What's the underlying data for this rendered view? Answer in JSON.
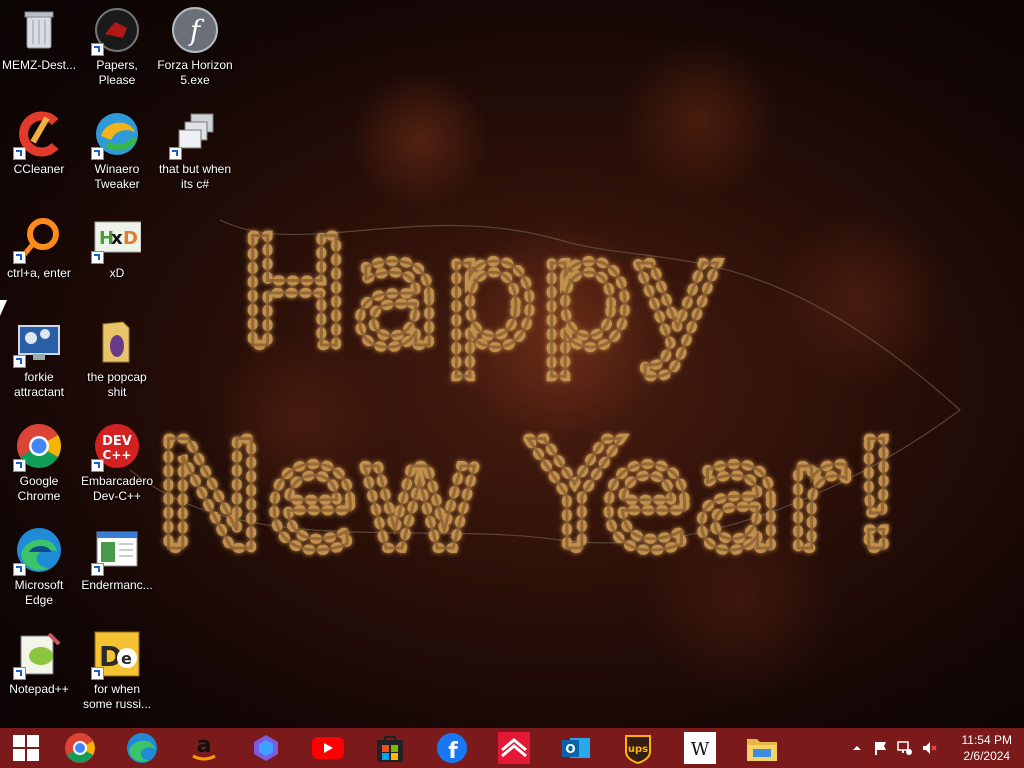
{
  "desktop_icons": [
    {
      "label": "MEMZ-Dest...",
      "icon": "recycle-bin-icon"
    },
    {
      "label": "Papers, Please",
      "icon": "papers-please-icon"
    },
    {
      "label": "Forza Horizon 5.exe",
      "icon": "flash-icon"
    },
    {
      "label": "CCleaner",
      "icon": "ccleaner-icon"
    },
    {
      "label": "Winaero Tweaker",
      "icon": "winaero-icon"
    },
    {
      "label": "that but when its c#",
      "icon": "windows-stack-icon"
    },
    {
      "label": "ctrl+a, enter",
      "icon": "ring-icon"
    },
    {
      "label": "xD",
      "icon": "hxd-icon"
    },
    {
      "label": "forkie attractant",
      "icon": "settings-monitor-icon"
    },
    {
      "label": "the popcap shit",
      "icon": "folder-icon"
    },
    {
      "label": "Google Chrome",
      "icon": "chrome-icon"
    },
    {
      "label": "Embarcadero Dev-C++",
      "icon": "devcpp-icon"
    },
    {
      "label": "Microsoft Edge",
      "icon": "edge-icon"
    },
    {
      "label": "Endermanc...",
      "icon": "document-icon"
    },
    {
      "label": "Notepad++",
      "icon": "notepadpp-icon"
    },
    {
      "label": "for when some russi...",
      "icon": "de-icon"
    }
  ],
  "wallpaper": {
    "line1": "Happy",
    "line2": "New Year!"
  },
  "taskbar": {
    "apps": [
      "start-icon",
      "chrome-icon",
      "edge-icon",
      "amazon-icon",
      "copilot-icon",
      "youtube-icon",
      "store-icon",
      "facebook-icon",
      "bank-of-america-icon",
      "outlook-icon",
      "ups-icon",
      "wikipedia-icon",
      "file-explorer-icon"
    ],
    "wikipedia_glyph": "W",
    "time": "11:54 PM",
    "date": "2/6/2024"
  },
  "colors": {
    "taskbar": "#7a1a1a",
    "bulb": "#ffd978",
    "neon": "#b8894a"
  }
}
